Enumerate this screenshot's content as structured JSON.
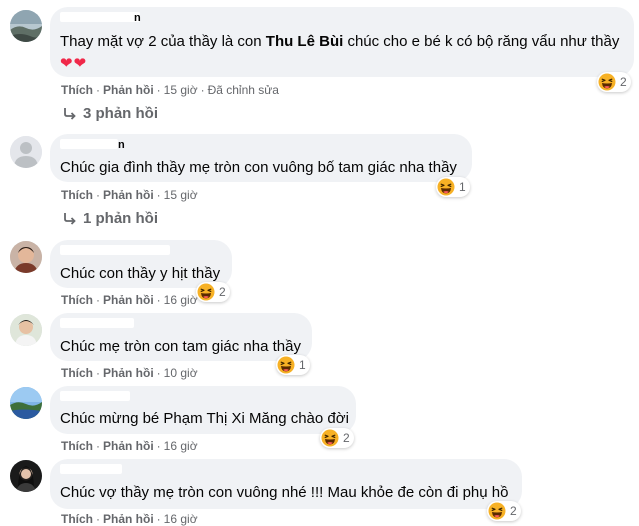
{
  "comments": [
    {
      "author_visible": "n",
      "text_pre": "Thay mặt vợ 2 của thầy là con ",
      "tag": "Thu Lê Bùi",
      "text_post": " chúc cho e bé k có bộ răng vẩu như thầy",
      "hearts": "❤❤",
      "reaction_count": "2",
      "like": "Thích",
      "reply": "Phản hồi",
      "time": "15 giờ",
      "edited": "Đã chỉnh sửa",
      "replies": "3 phản hồi"
    },
    {
      "author_visible": "n",
      "text": "Chúc gia đình thầy mẹ tròn con vuông bố tam giác nha thầy",
      "reaction_count": "1",
      "like": "Thích",
      "reply": "Phản hồi",
      "time": "15 giờ",
      "replies": "1 phản hồi"
    },
    {
      "text": "Chúc con thầy y hịt thầy",
      "reaction_count": "2",
      "like": "Thích",
      "reply": "Phản hồi",
      "time": "16 giờ"
    },
    {
      "text": "Chúc mẹ tròn con tam giác nha thầy",
      "reaction_count": "1",
      "like": "Thích",
      "reply": "Phản hồi",
      "time": "10 giờ"
    },
    {
      "text": "Chúc mừng bé Phạm Thị Xi Măng chào đời",
      "reaction_count": "2",
      "like": "Thích",
      "reply": "Phản hồi",
      "time": "16 giờ"
    },
    {
      "text": "Chúc vợ thầy mẹ tròn con vuông nhé !!! Mau khỏe đe còn đi phụ hồ",
      "reaction_count": "2",
      "like": "Thích",
      "reply": "Phản hồi",
      "time": "16 giờ"
    }
  ],
  "colors": {
    "bubble": "#f0f2f5",
    "meta": "#65676b",
    "heart": "#f02849",
    "haha": "#f7b125"
  },
  "icons": {
    "reaction": "haha-emoji-icon",
    "replies": "reply-arrow-icon",
    "avatar_default": "default-avatar-icon"
  }
}
